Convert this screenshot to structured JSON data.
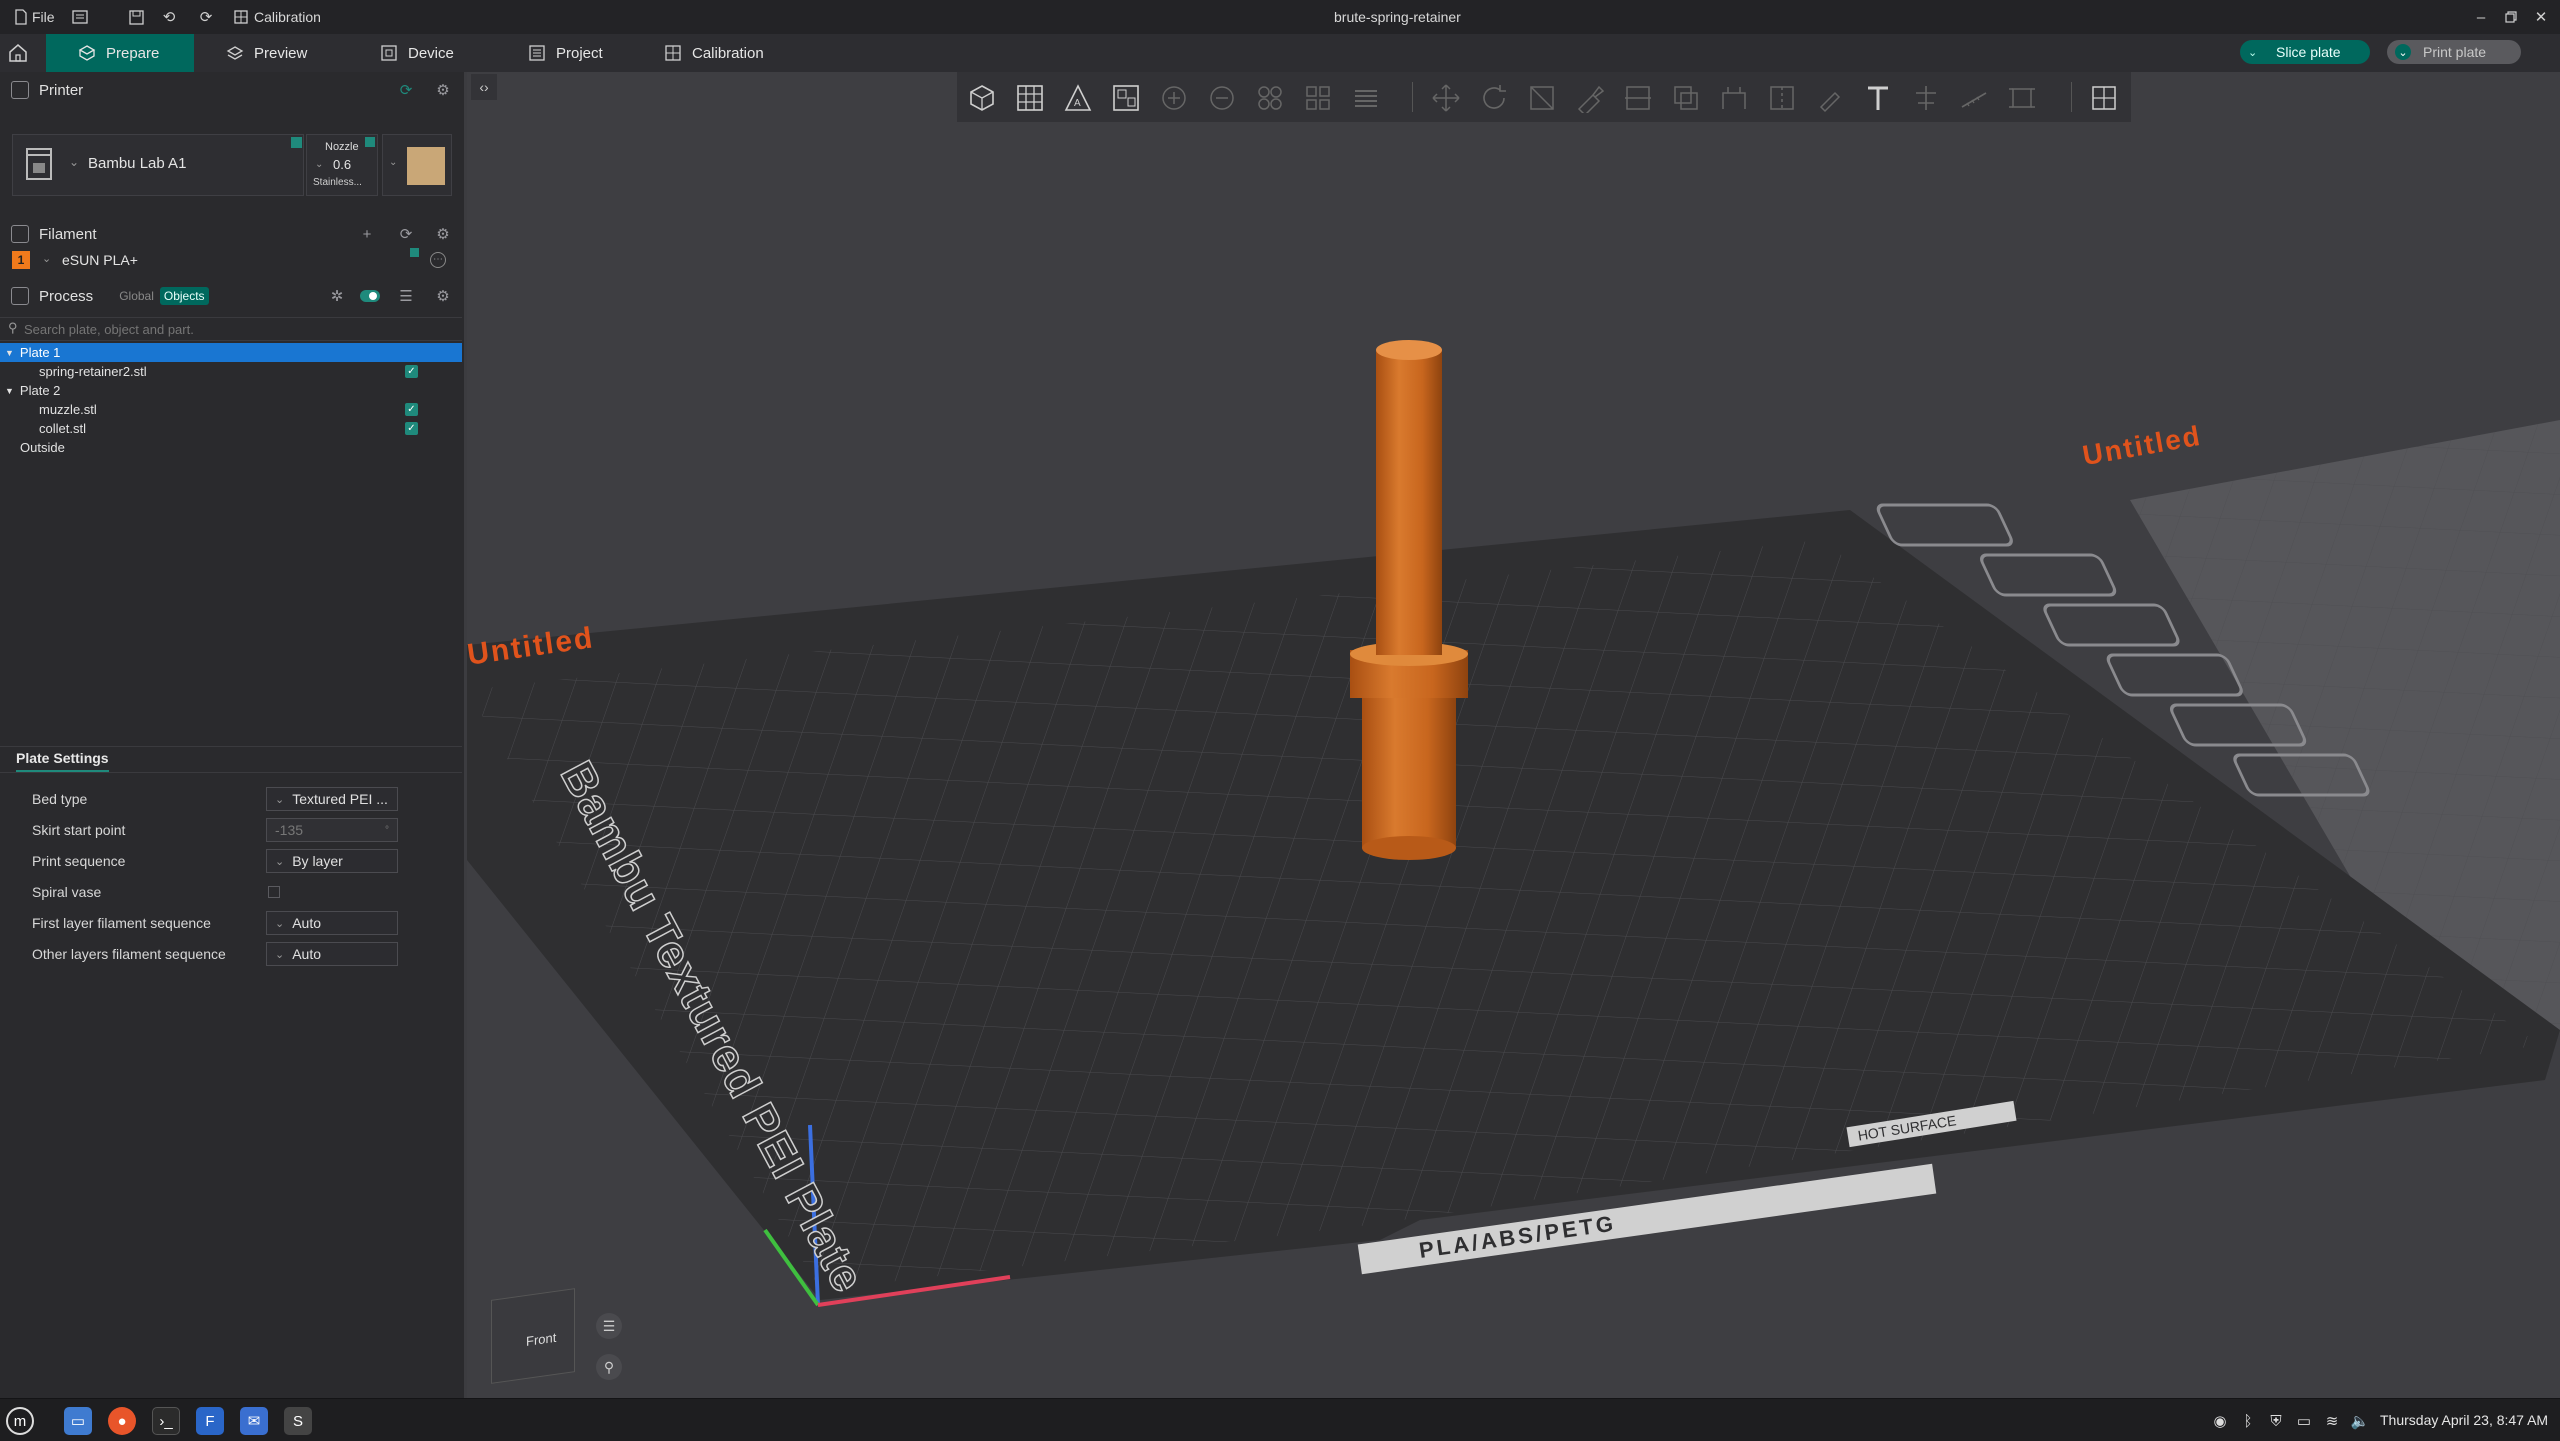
{
  "titlebar": {
    "file_label": "File",
    "calibration_label": "Calibration",
    "window_title": "brute-spring-retainer"
  },
  "tabs": [
    {
      "label": "Prepare"
    },
    {
      "label": "Preview"
    },
    {
      "label": "Device"
    },
    {
      "label": "Project"
    },
    {
      "label": "Calibration"
    }
  ],
  "actions": {
    "slice_label": "Slice plate",
    "print_label": "Print plate"
  },
  "printer": {
    "section_label": "Printer",
    "name": "Bambu Lab A1",
    "nozzle_label": "Nozzle",
    "nozzle_size": "0.6",
    "nozzle_type": "Stainless..."
  },
  "filament": {
    "section_label": "Filament",
    "slot_number": "1",
    "name": "eSUN PLA+",
    "color": "#f07a1c"
  },
  "process": {
    "section_label": "Process",
    "global_label": "Global",
    "objects_label": "Objects"
  },
  "search": {
    "placeholder": "Search plate, object and part."
  },
  "object_tree": {
    "plate1": "Plate 1",
    "plate1_items": [
      "spring-retainer2.stl"
    ],
    "plate2": "Plate 2",
    "plate2_items": [
      "muzzle.stl",
      "collet.stl"
    ],
    "outside": "Outside"
  },
  "plate_settings": {
    "title": "Plate Settings",
    "rows": [
      {
        "label": "Bed type",
        "value": "Textured PEI ..."
      },
      {
        "label": "Skirt start point",
        "value": "-135"
      },
      {
        "label": "Print sequence",
        "value": "By layer"
      },
      {
        "label": "Spiral vase",
        "value": ""
      },
      {
        "label": "First layer filament sequence",
        "value": "Auto"
      },
      {
        "label": "Other layers filament sequence",
        "value": "Auto"
      }
    ]
  },
  "scene": {
    "plate_name_main": "Untitled",
    "plate_name_second": "Untitled",
    "bed_brand_text": "Bambu Textured PEI Plate",
    "bed_material_text": "PLA/ABS/PETG",
    "bed_surface_text": "HOT SURFACE",
    "model_color": "#c8661e",
    "view_cube_label": "Front"
  },
  "taskbar": {
    "datetime": "Thursday April 23, 8:47 AM"
  },
  "colors": {
    "accent": "#00685d",
    "accent_light": "#1f8a7c",
    "selection": "#1976d2",
    "bed": "#2f2f31"
  }
}
